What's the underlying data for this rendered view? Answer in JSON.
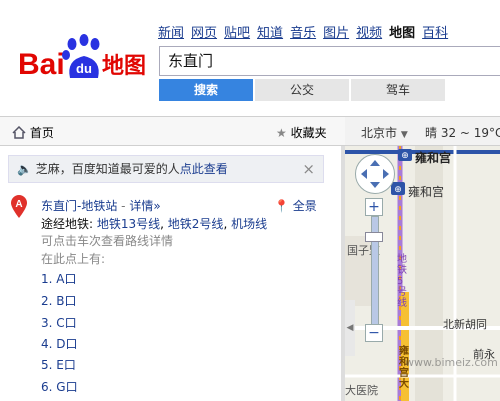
{
  "brand": {
    "logo_text_bai": "Bai",
    "logo_text_du": "du",
    "logo_text_map": "地图"
  },
  "nav": {
    "items": [
      "新闻",
      "网页",
      "贴吧",
      "知道",
      "音乐",
      "图片",
      "视频",
      "地图",
      "百科"
    ],
    "active_index": 7
  },
  "search": {
    "value": "东直门"
  },
  "tabs": [
    {
      "label": "搜索",
      "active": true
    },
    {
      "label": "公交",
      "active": false
    },
    {
      "label": "驾车",
      "active": false
    }
  ],
  "toolbar": {
    "home_label": "首页",
    "favorite_label": "收藏夹",
    "city_label": "北京市",
    "weather_label": "晴 32 ~ 19°C"
  },
  "notice": {
    "text": "芝麻，百度知道最可爱的人",
    "link": "点此查看",
    "close": "×"
  },
  "result": {
    "marker": "A",
    "title": "东直门-地铁站",
    "detail_link": "详情»",
    "full_view_label": "全景",
    "lines_prefix": "途经地铁:",
    "lines": [
      "地铁13号线",
      "地铁2号线",
      "机场线"
    ],
    "transfer_note": "可点击车次查看路线详情",
    "exits_heading": "在此点上有:",
    "exits": [
      "1. A口",
      "2. B口",
      "3. C口",
      "4. D口",
      "5. E口",
      "6. G口"
    ]
  },
  "map": {
    "station_top": "雍和宫",
    "station_mid": "雍和宫",
    "road_label_vertical": "地铁5号线",
    "place_1": "国子监",
    "place_2": "北新胡同",
    "place_3": "前永",
    "place_4": "大医院",
    "road_yellow": "雍和宫大",
    "watermark": "www.bimeiz.com"
  },
  "colors": {
    "brand_red": "#e10602",
    "brand_blue": "#2932e1",
    "tab_active": "#3684e0",
    "link": "#1a3c8f",
    "marker_red": "#e0312b"
  }
}
